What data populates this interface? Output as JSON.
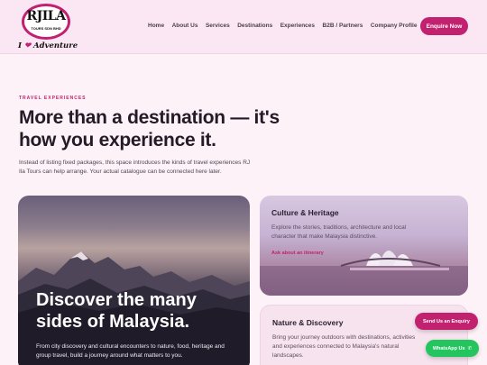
{
  "logo": {
    "name": "RJILA",
    "subtitle": "TOURS SDN BHD",
    "tagline_before": "I",
    "tagline_after": "Adventure"
  },
  "nav": {
    "items": [
      "Home",
      "About Us",
      "Services",
      "Destinations",
      "Experiences",
      "B2B / Partners",
      "Company Profile"
    ],
    "cta": "Enquire Now"
  },
  "hero": {
    "eyebrow": "TRAVEL EXPERIENCES",
    "title": "More than a destination — it's how you experience it.",
    "intro": "Instead of listing fixed packages, this space introduces the kinds of travel experiences RJ Ila Tours can help arrange. Your actual catalogue can be connected here later."
  },
  "feature_card": {
    "title": "Discover the many sides of Malaysia.",
    "description": "From city discovery and cultural encounters to nature, food, heritage and group travel, build a journey around what matters to you."
  },
  "cards": [
    {
      "title": "Culture & Heritage",
      "description": "Explore the stories, traditions, architecture and local character that make Malaysia distinctive.",
      "link": "Ask about an itinerary"
    },
    {
      "title": "Nature & Discovery",
      "description": "Bring your journey outdoors with destinations, activities and experiences connected to Malaysia's natural landscapes."
    }
  ],
  "floating": {
    "enquiry": "Send Us an Enquiry",
    "whatsapp": "WhatsApp Us"
  },
  "colors": {
    "accent": "#c2216f",
    "background": "#fdf2f8",
    "whatsapp": "#22c55e"
  }
}
